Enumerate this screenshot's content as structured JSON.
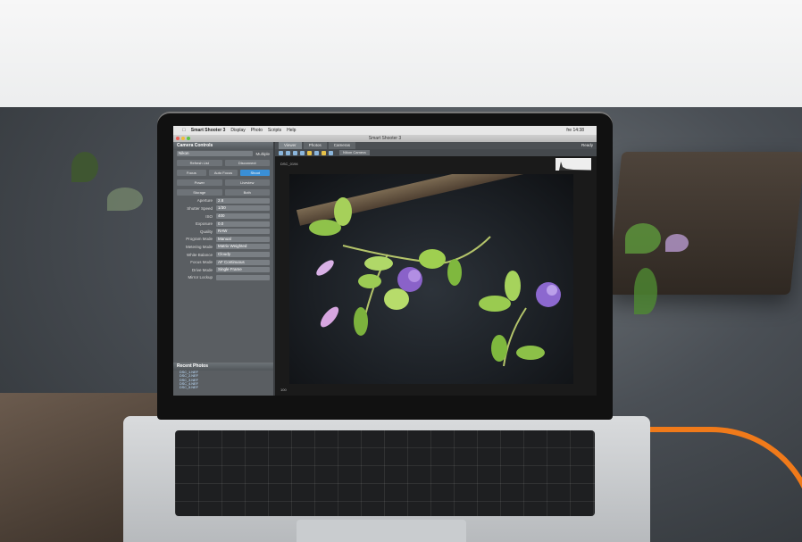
{
  "menubar": {
    "app_name": "Smart Shooter 3",
    "menus": [
      "Display",
      "Photo",
      "Scripts",
      "Help"
    ],
    "clock": "fre 14:38"
  },
  "window": {
    "title": "Smart Shooter 3"
  },
  "left_panel": {
    "title": "Camera Controls",
    "camera_select": "Nikon",
    "multiple_label": "Multiple",
    "buttons_row1": [
      "Refresh List",
      "Disconnect"
    ],
    "buttons_row2": [
      "Focus",
      "Auto Focus",
      "Shoot"
    ],
    "power_label": "Power",
    "liveview_label": "Liveview",
    "storage_label": "Storage",
    "storage_value": "Both",
    "controls": [
      {
        "label": "Aperture",
        "value": "2.8"
      },
      {
        "label": "Shutter Speed",
        "value": "1/30"
      },
      {
        "label": "ISO",
        "value": "400"
      },
      {
        "label": "Exposure",
        "value": "0.0"
      },
      {
        "label": "Quality",
        "value": "RAW"
      },
      {
        "label": "Program Mode",
        "value": "Manual"
      },
      {
        "label": "Metering Mode",
        "value": "Matrix Weighted"
      },
      {
        "label": "White Balance",
        "value": "Cloudy"
      },
      {
        "label": "Focus Mode",
        "value": "AF Continuous"
      },
      {
        "label": "Drive Mode",
        "value": "Single Frame"
      },
      {
        "label": "Mirror Lockup",
        "value": ""
      }
    ]
  },
  "recent_photos": {
    "title": "Recent Photos",
    "items": [
      "DSC_1.NEF",
      "DSC_2.NEF",
      "DSC_3.NEF",
      "DSC_4.NEF",
      "DSC_5.NEF"
    ]
  },
  "main": {
    "tabs": [
      "Viewer",
      "Photos",
      "Cameras"
    ],
    "status": "Ready",
    "camera_select": "Nikon Camera",
    "image_name": "DSC_0194",
    "image_size": "4912x3264",
    "zoom": "100"
  },
  "colors": {
    "accent": "#3a8fd6",
    "cable": "#f07a1a"
  }
}
